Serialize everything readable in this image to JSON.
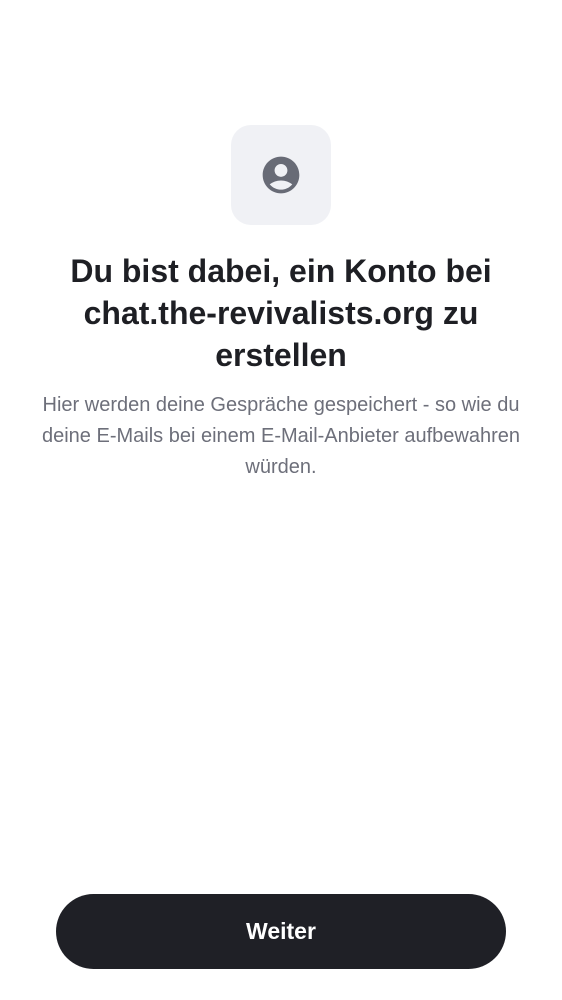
{
  "onboarding": {
    "icon": "account-circle-icon",
    "title": "Du bist dabei, ein Konto bei chat.the-revivalists.org zu erstellen",
    "description": "Hier werden deine Gespräche gespeichert - so wie du deine E-Mails bei einem E-Mail-Anbieter aufbewahren würden.",
    "continue_label": "Weiter"
  },
  "colors": {
    "background": "#ffffff",
    "icon_tile": "#f0f1f5",
    "icon": "#686b76",
    "title_text": "#1e1f24",
    "description_text": "#6d6f7a",
    "button_background": "#1f2026",
    "button_text": "#ffffff"
  }
}
